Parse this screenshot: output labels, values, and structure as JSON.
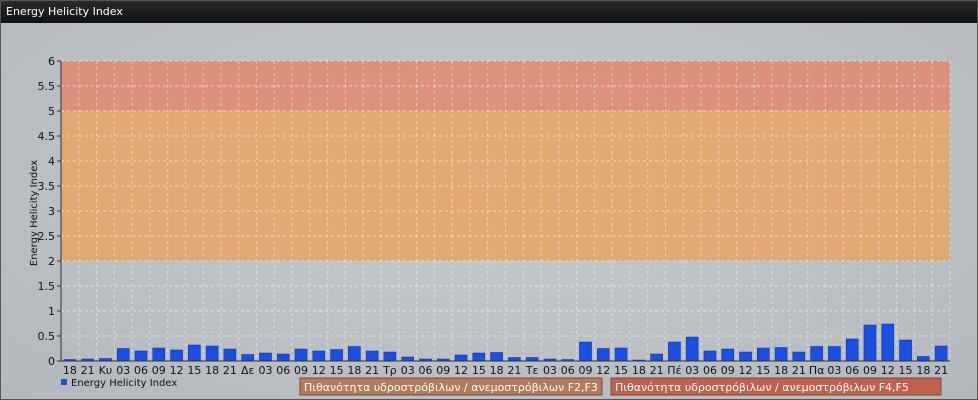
{
  "window": {
    "title": "Energy Helicity Index"
  },
  "chart_data": {
    "type": "bar",
    "ylabel": "Energy Helicity Index",
    "ylim": [
      0,
      6
    ],
    "yticks": [
      "0",
      "0.5",
      "1",
      "1.5",
      "2",
      "2.5",
      "3",
      "3.5",
      "4",
      "4.5",
      "5",
      "5.5",
      "6"
    ],
    "grid": true,
    "bands": [
      {
        "from": 2,
        "to": 5,
        "color": "#e3a66b"
      },
      {
        "from": 5,
        "to": 6,
        "color": "#e08c74"
      }
    ],
    "categories": [
      "18",
      "21",
      "Κυ",
      "03",
      "06",
      "09",
      "12",
      "15",
      "18",
      "21",
      "Δε",
      "03",
      "06",
      "09",
      "12",
      "15",
      "18",
      "21",
      "Τρ",
      "03",
      "06",
      "09",
      "12",
      "15",
      "18",
      "21",
      "Τε",
      "03",
      "06",
      "09",
      "12",
      "15",
      "18",
      "21",
      "Πέ",
      "03",
      "06",
      "09",
      "12",
      "15",
      "18",
      "21",
      "Πα",
      "03",
      "06",
      "09",
      "12",
      "15",
      "18",
      "21"
    ],
    "series": [
      {
        "name": "Energy Helicity Index",
        "color": "#1a4fe0",
        "values": [
          0.03,
          0.04,
          0.05,
          0.25,
          0.2,
          0.26,
          0.22,
          0.32,
          0.3,
          0.24,
          0.13,
          0.16,
          0.14,
          0.24,
          0.2,
          0.23,
          0.29,
          0.2,
          0.18,
          0.08,
          0.04,
          0.04,
          0.12,
          0.16,
          0.17,
          0.07,
          0.07,
          0.04,
          0.03,
          0.38,
          0.25,
          0.26,
          0.02,
          0.14,
          0.38,
          0.48,
          0.2,
          0.24,
          0.18,
          0.26,
          0.27,
          0.18,
          0.29,
          0.29,
          0.44,
          0.72,
          0.74,
          0.42,
          0.09,
          0.3
        ]
      }
    ],
    "legend_position": "bottom-left"
  },
  "badges": [
    {
      "label": "Πιθανότητα υδροστρόβιλων / ανεμοστρόβιλων F2,F3",
      "color": "#b47a5c"
    },
    {
      "label": "Πιθανότητα υδροστρόβιλων / ανεμοστρόβιλων F4,F5",
      "color": "#c0614e"
    }
  ]
}
